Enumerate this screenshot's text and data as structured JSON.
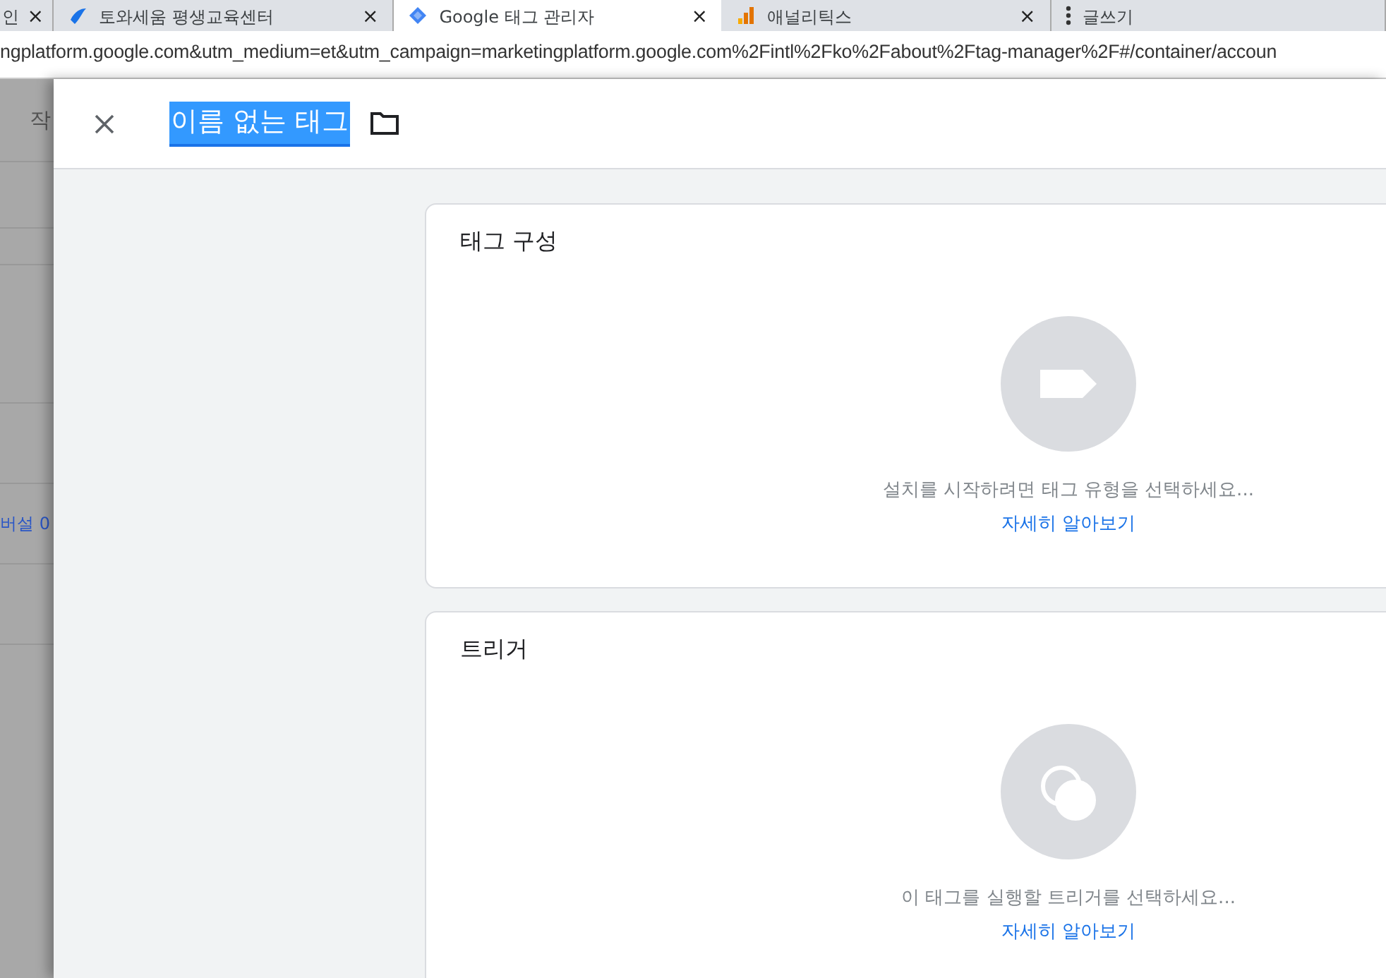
{
  "browser": {
    "tabs": [
      {
        "title": "인",
        "kind": "plain",
        "close": "×",
        "selected": false
      },
      {
        "title": "토와세움 평생교육센터",
        "kind": "bird",
        "close": "×",
        "selected": false
      },
      {
        "title": "Google 태그 관리자",
        "kind": "diamond",
        "close": "×",
        "selected": true
      },
      {
        "title": "애널리틱스",
        "kind": "bars",
        "close": "×",
        "selected": false
      },
      {
        "title": "글쓰기",
        "kind": "dots",
        "selected": false
      }
    ],
    "address": "ngplatform.google.com&utm_medium=et&utm_campaign=marketingplatform.google.com%2Fintl%2Fko%2Fabout%2Ftag-manager%2F#/container/accoun"
  },
  "background_page": {
    "header_text": "작",
    "link_text": "버설 0"
  },
  "panel": {
    "title": "이름 없는 태그",
    "title_highlighted": true,
    "cards": [
      {
        "kind": "tag",
        "title": "태그 구성",
        "message": "설치를 시작하려면 태그 유형을 선택하세요...",
        "link": "자세히 알아보기"
      },
      {
        "kind": "trigger",
        "title": "트리거",
        "message": "이 태그를 실행할 트리거를 선택하세요...",
        "link": "자세히 알아보기"
      }
    ]
  }
}
